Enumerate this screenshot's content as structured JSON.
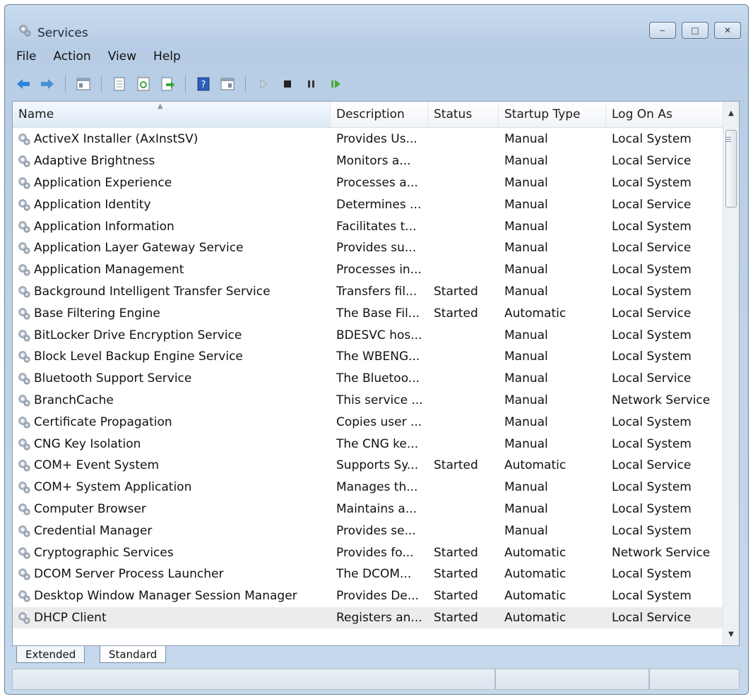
{
  "window": {
    "title": "Services",
    "icon": "services-gear-icon"
  },
  "menu": [
    "File",
    "Action",
    "View",
    "Help"
  ],
  "toolbar": [
    "back-arrow-icon",
    "forward-arrow-icon",
    "show-console-tree-icon",
    "properties-icon",
    "refresh-icon",
    "export-list-icon",
    "help-icon",
    "show-action-pane-icon",
    "start-service-icon",
    "stop-service-icon",
    "pause-service-icon",
    "restart-service-icon"
  ],
  "columns": {
    "name": "Name",
    "description": "Description",
    "status": "Status",
    "startup": "Startup Type",
    "logon": "Log On As"
  },
  "services": [
    {
      "name": "ActiveX Installer (AxInstSV)",
      "description": "Provides Us...",
      "status": "",
      "startup": "Manual",
      "logon": "Local System"
    },
    {
      "name": "Adaptive Brightness",
      "description": "Monitors a...",
      "status": "",
      "startup": "Manual",
      "logon": "Local Service"
    },
    {
      "name": "Application Experience",
      "description": "Processes a...",
      "status": "",
      "startup": "Manual",
      "logon": "Local System"
    },
    {
      "name": "Application Identity",
      "description": "Determines ...",
      "status": "",
      "startup": "Manual",
      "logon": "Local Service"
    },
    {
      "name": "Application Information",
      "description": "Facilitates t...",
      "status": "",
      "startup": "Manual",
      "logon": "Local System"
    },
    {
      "name": "Application Layer Gateway Service",
      "description": "Provides su...",
      "status": "",
      "startup": "Manual",
      "logon": "Local Service"
    },
    {
      "name": "Application Management",
      "description": "Processes in...",
      "status": "",
      "startup": "Manual",
      "logon": "Local System"
    },
    {
      "name": "Background Intelligent Transfer Service",
      "description": "Transfers fil...",
      "status": "Started",
      "startup": "Manual",
      "logon": "Local System"
    },
    {
      "name": "Base Filtering Engine",
      "description": "The Base Fil...",
      "status": "Started",
      "startup": "Automatic",
      "logon": "Local Service"
    },
    {
      "name": "BitLocker Drive Encryption Service",
      "description": "BDESVC hos...",
      "status": "",
      "startup": "Manual",
      "logon": "Local System"
    },
    {
      "name": "Block Level Backup Engine Service",
      "description": "The WBENG...",
      "status": "",
      "startup": "Manual",
      "logon": "Local System"
    },
    {
      "name": "Bluetooth Support Service",
      "description": "The Bluetoo...",
      "status": "",
      "startup": "Manual",
      "logon": "Local Service"
    },
    {
      "name": "BranchCache",
      "description": "This service ...",
      "status": "",
      "startup": "Manual",
      "logon": "Network Service"
    },
    {
      "name": "Certificate Propagation",
      "description": "Copies user ...",
      "status": "",
      "startup": "Manual",
      "logon": "Local System"
    },
    {
      "name": "CNG Key Isolation",
      "description": "The CNG ke...",
      "status": "",
      "startup": "Manual",
      "logon": "Local System"
    },
    {
      "name": "COM+ Event System",
      "description": "Supports Sy...",
      "status": "Started",
      "startup": "Automatic",
      "logon": "Local Service"
    },
    {
      "name": "COM+ System Application",
      "description": "Manages th...",
      "status": "",
      "startup": "Manual",
      "logon": "Local System"
    },
    {
      "name": "Computer Browser",
      "description": "Maintains a...",
      "status": "",
      "startup": "Manual",
      "logon": "Local System"
    },
    {
      "name": "Credential Manager",
      "description": "Provides se...",
      "status": "",
      "startup": "Manual",
      "logon": "Local System"
    },
    {
      "name": "Cryptographic Services",
      "description": "Provides fo...",
      "status": "Started",
      "startup": "Automatic",
      "logon": "Network Service"
    },
    {
      "name": "DCOM Server Process Launcher",
      "description": "The DCOM...",
      "status": "Started",
      "startup": "Automatic",
      "logon": "Local System"
    },
    {
      "name": "Desktop Window Manager Session Manager",
      "description": "Provides De...",
      "status": "Started",
      "startup": "Automatic",
      "logon": "Local System"
    },
    {
      "name": "DHCP Client",
      "description": "Registers an...",
      "status": "Started",
      "startup": "Automatic",
      "logon": "Local Service",
      "selected": true
    }
  ],
  "tabs": [
    "Extended",
    "Standard"
  ],
  "colors": {
    "title_bg": "#c9dcef",
    "selected_row": "#ececec",
    "back_arrow": "#2f86d6",
    "forward_arrow": "#4a8fd0",
    "play": "#4aa83a"
  }
}
